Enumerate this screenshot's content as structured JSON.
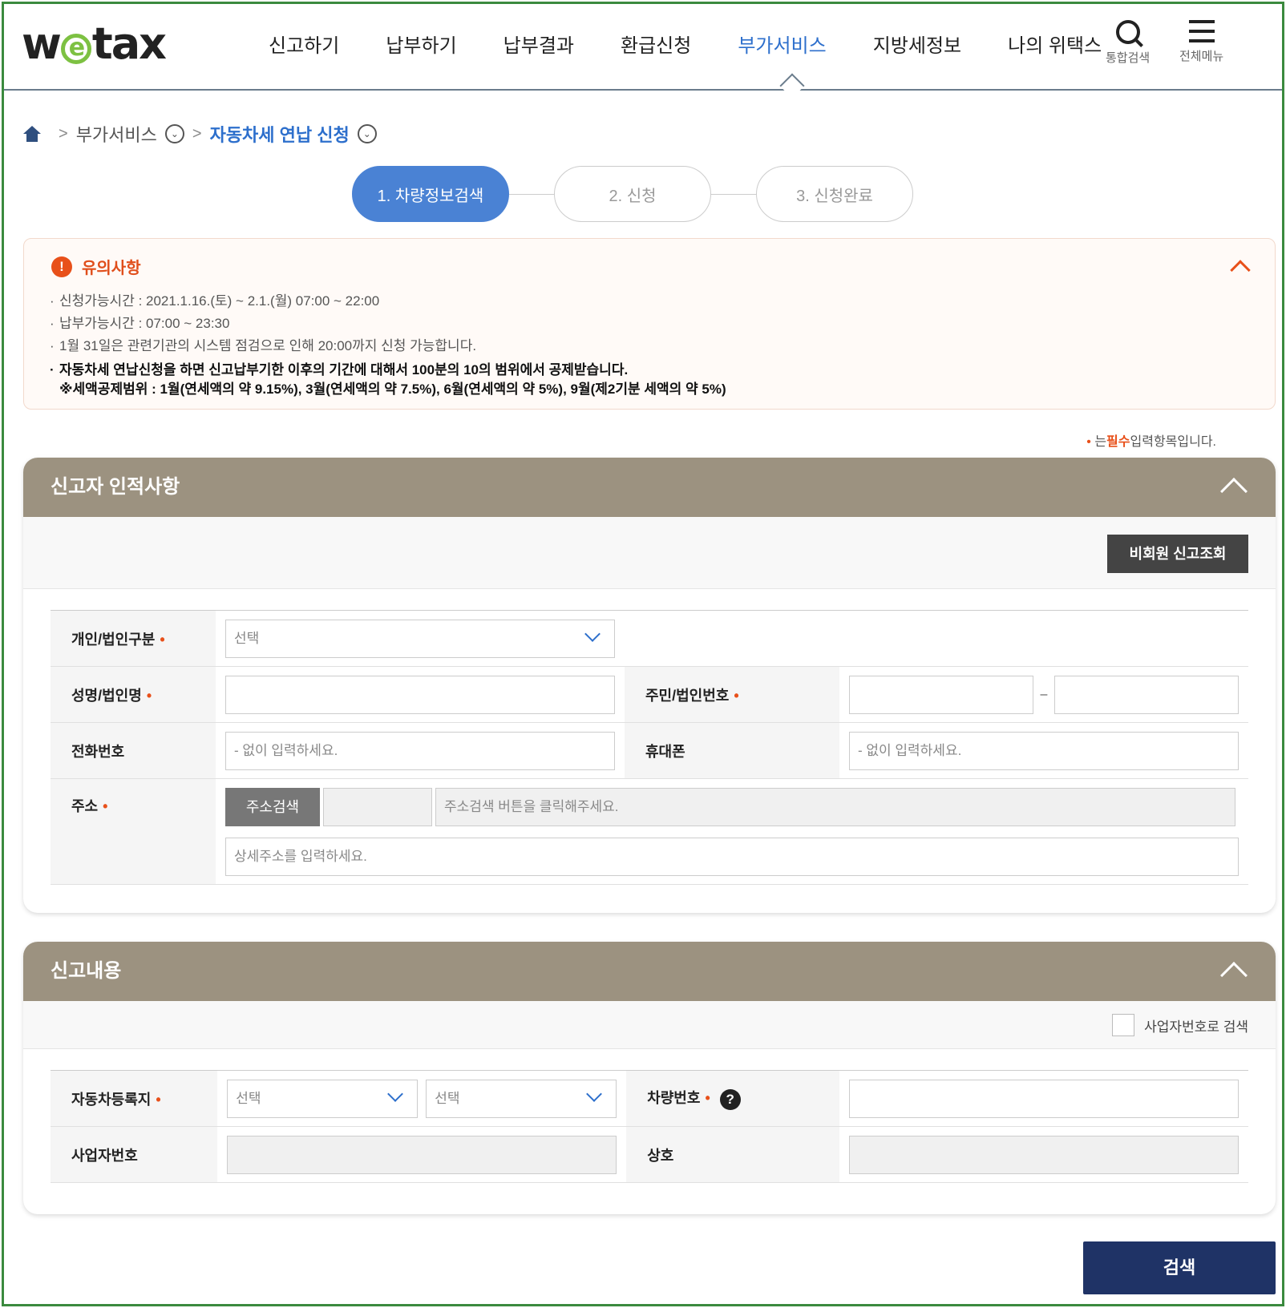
{
  "header": {
    "logo_left": "w",
    "logo_e": "e",
    "logo_right": "tax",
    "nav": [
      "신고하기",
      "납부하기",
      "납부결과",
      "환급신청",
      "부가서비스",
      "지방세정보",
      "나의 위택스"
    ],
    "active_nav_index": 4,
    "search_label": "통합검색",
    "menu_label": "전체메뉴"
  },
  "breadcrumb": {
    "level1": "부가서비스",
    "level2": "자동차세 연납 신청"
  },
  "steps": [
    "1. 차량정보검색",
    "2. 신청",
    "3. 신청완료"
  ],
  "notice": {
    "title": "유의사항",
    "items": [
      "신청가능시간 : 2021.1.16.(토) ~ 2.1.(월) 07:00 ~ 22:00",
      "납부가능시간 : 07:00 ~ 23:30",
      "1월 31일은 관련기관의 시스템 점검으로 인해 20:00까지 신청 가능합니다."
    ],
    "bold_line1": "자동차세 연납신청을 하면 신고납부기한 이후의 기간에 대해서 100분의 10의 범위에서 공제받습니다.",
    "bold_line2": "※세액공제범위 : 1월(연세액의 약 9.15%), 3월(연세액의 약 7.5%), 6월(연세액의 약 5%), 9월(제2기분 세액의 약 5%)"
  },
  "required_note": {
    "dot": "•",
    "pre": "는",
    "highlight": "필수",
    "post": "입력항목입니다."
  },
  "reporter": {
    "title": "신고자 인적사항",
    "nonmember_button": "비회원 신고조회",
    "type_label": "개인/법인구분",
    "type_value": "선택",
    "name_label": "성명/법인명",
    "id_label": "주민/법인번호",
    "id_sep": "–",
    "phone_label": "전화번호",
    "phone_placeholder": "- 없이 입력하세요.",
    "mobile_label": "휴대폰",
    "mobile_placeholder": "- 없이 입력하세요.",
    "address_label": "주소",
    "address_search_button": "주소검색",
    "address_placeholder": "주소검색 버튼을 클릭해주세요.",
    "address_detail_placeholder": "상세주소를 입력하세요."
  },
  "report": {
    "title": "신고내용",
    "biz_checkbox_label": "사업자번호로 검색",
    "region_label": "자동차등록지",
    "region_select1": "선택",
    "region_select2": "선택",
    "car_number_label": "차량번호",
    "help": "?",
    "biz_number_label": "사업자번호",
    "company_label": "상호"
  },
  "search_button": "검색",
  "required_mark": "•",
  "colors": {
    "accent": "#2d6fcc",
    "panel_header": "#9c9280",
    "warning": "#e8501a",
    "primary_button": "#1f3366",
    "logo_green": "#7dc142"
  }
}
